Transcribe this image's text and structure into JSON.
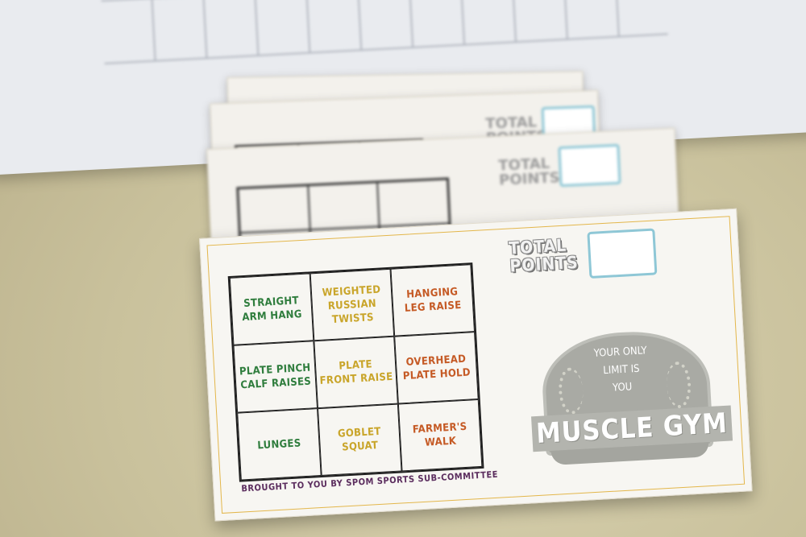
{
  "scorecard": {
    "total_label": "TOTAL POINTS",
    "cells": [
      {
        "text": "STRAIGHT\nARM HANG",
        "color": "#2f7d3d"
      },
      {
        "text": "WEIGHTED\nRUSSIAN\nTWISTS",
        "color": "#c9a52a"
      },
      {
        "text": "HANGING\nLEG RAISE",
        "color": "#c55a25"
      },
      {
        "text": "PLATE PINCH\nCALF RAISES",
        "color": "#2f7d3d"
      },
      {
        "text": "PLATE\nFRONT RAISE",
        "color": "#c9a52a"
      },
      {
        "text": "OVERHEAD\nPLATE HOLD",
        "color": "#c55a25"
      },
      {
        "text": "LUNGES",
        "color": "#2f7d3d"
      },
      {
        "text": "GOBLET\nSQUAT",
        "color": "#c9a52a"
      },
      {
        "text": "FARMER'S\nWALK",
        "color": "#c55a25"
      }
    ],
    "logo": {
      "motto": "YOUR ONLY\nLIMIT IS\nYOU",
      "name": "MUSCLE GYM"
    },
    "credit": "BROUGHT TO YOU BY SPOM SPORTS SUB-COMMITTEE"
  },
  "background_card": {
    "total_label": "TOTAL POINTS"
  },
  "colors": {
    "green": "#2f7d3d",
    "gold": "#c9a52a",
    "orange": "#c55a25",
    "points_box": "#8ec7d6",
    "card_border": "#e3b64a"
  }
}
